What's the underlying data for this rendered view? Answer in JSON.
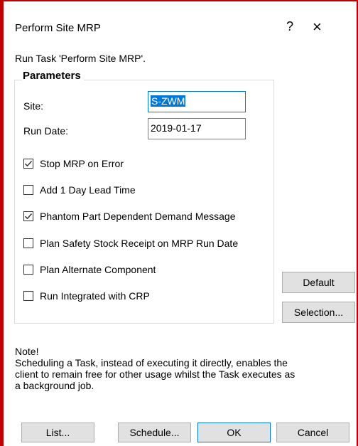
{
  "dialog": {
    "title": "Perform Site MRP",
    "help_glyph": "?",
    "close_glyph": "×"
  },
  "run_task": "Run Task 'Perform Site MRP'.",
  "parameters": {
    "legend": "Parameters",
    "site_label": "Site:",
    "site_value": "S-ZWM",
    "run_date_label": "Run Date:",
    "run_date_value": "2019-01-17"
  },
  "options": [
    {
      "label": "Stop MRP on Error",
      "checked": true
    },
    {
      "label": "Add 1 Day Lead Time",
      "checked": false
    },
    {
      "label": "Phantom Part Dependent Demand Message",
      "checked": true
    },
    {
      "label": "Plan Safety Stock Receipt on MRP Run Date",
      "checked": false
    },
    {
      "label": "Plan Alternate Component",
      "checked": false
    },
    {
      "label": "Run Integrated with CRP",
      "checked": false
    }
  ],
  "side_buttons": {
    "default": "Default",
    "selection": "Selection..."
  },
  "note": {
    "heading": "Note!",
    "line1": "Scheduling a Task, instead of executing it directly, enables the",
    "line2": "client  to remain free for other usage whilst the Task executes as",
    "line3": "a background job."
  },
  "footer_buttons": {
    "list": "List...",
    "schedule": "Schedule...",
    "ok": "OK",
    "cancel": "Cancel"
  },
  "colors": {
    "accent": "#0078d7",
    "frame": "#c00000"
  }
}
